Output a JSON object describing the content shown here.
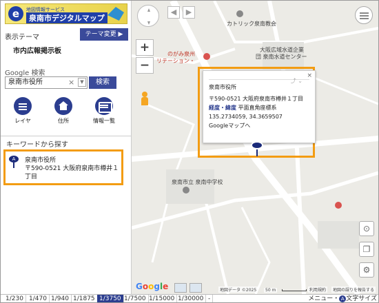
{
  "app": {
    "logo_sub": "地図情報サービス",
    "logo_main": "泉南市デジタルマップ"
  },
  "sidebar": {
    "theme_label": "表示テーマ",
    "theme_button": "テーマ変更 ▶",
    "theme_value": "市内広報掲示板",
    "google_label": "Google 検索",
    "search_value": "泉南市役所",
    "clear_symbol": "×",
    "search_button": "検索",
    "tools": [
      {
        "label": "レイヤ"
      },
      {
        "label": "住所"
      },
      {
        "label": "情報一覧"
      }
    ],
    "keyword_head": "キーワードから探す",
    "result": {
      "marker": "A",
      "name": "泉南市役所",
      "address": "〒590-0521 大阪府泉南市樽井１丁目"
    },
    "collapse_symbol": "«"
  },
  "map": {
    "labels": [
      {
        "text": "カトリック泉南教会",
        "cls": ""
      },
      {
        "text": "のがみ泉州",
        "cls": "red"
      },
      {
        "text": "リテーション・",
        "cls": "red"
      },
      {
        "text": "大阪広域水道企業",
        "cls": ""
      },
      {
        "text": "団 泉南水道センター",
        "cls": ""
      },
      {
        "text": "泉南市立 泉南中学校",
        "cls": ""
      }
    ],
    "popup": {
      "name": "泉南市役所",
      "address": "〒590-0521 大阪府泉南市樽井１丁目",
      "coord_label": "経度・緯度",
      "coord_system": "平面直角座標系",
      "coords": "135.2734059, 34.3659507",
      "google_link": "Googleマップへ",
      "close_symbol": "×"
    },
    "attribution": {
      "data": "地図データ ©2025",
      "scale": "50 m",
      "terms": "利用規約",
      "report": "地図の誤りを報告する"
    },
    "google_letters": [
      "G",
      "o",
      "o",
      "g",
      "l",
      "e"
    ]
  },
  "scales": [
    "1/230",
    "1/470",
    "1/940",
    "1/1875",
    "1/3750",
    "1/7500",
    "1/15000",
    "1/30000",
    "-"
  ],
  "active_scale": "1/3750",
  "bottom": {
    "menu": "メニュー・",
    "font_icon": "A",
    "font_size": "文字サイズ"
  }
}
